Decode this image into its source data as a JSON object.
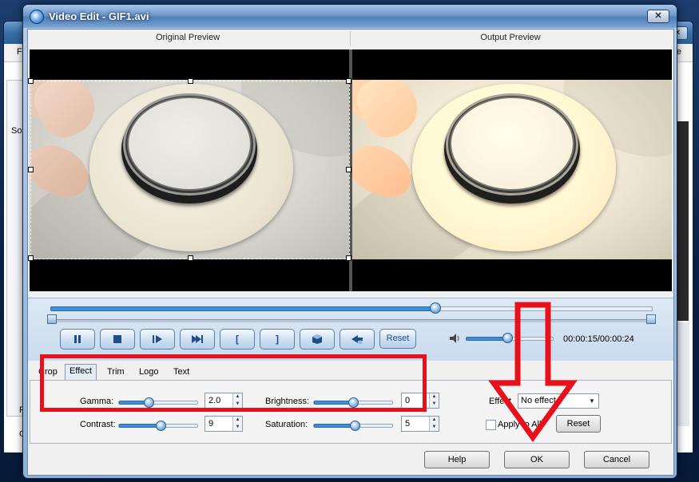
{
  "background_window": {
    "menu_left": "Fi",
    "menu_right": "e",
    "close_glyph": "✕",
    "label_so": "So",
    "label_f": "F",
    "label_c": "C"
  },
  "dialog": {
    "title": "Video Edit - GIF1.avi",
    "close_glyph": "✕"
  },
  "previews": {
    "original_label": "Original Preview",
    "output_label": "Output Preview"
  },
  "playback": {
    "position_fraction": 0.64,
    "volume_fraction": 0.48,
    "time": "00:00:15/00:00:24",
    "reset_label": "Reset",
    "bracket_open": "[",
    "bracket_close": "]"
  },
  "tabs": [
    {
      "label": "Crop",
      "active": false
    },
    {
      "label": "Effect",
      "active": true
    },
    {
      "label": "Trim",
      "active": false
    },
    {
      "label": "Logo",
      "active": false
    },
    {
      "label": "Text",
      "active": false
    }
  ],
  "effect_panel": {
    "gamma": {
      "label": "Gamma:",
      "value": "2.0",
      "fraction": 0.38
    },
    "contrast": {
      "label": "Contrast:",
      "value": "9",
      "fraction": 0.53
    },
    "brightness": {
      "label": "Brightness:",
      "value": "0",
      "fraction": 0.5
    },
    "saturation": {
      "label": "Saturation:",
      "value": "5",
      "fraction": 0.52
    },
    "effect_label": "Effect",
    "effect_value": "No effect",
    "apply_to_all": "Apply to All",
    "reset_label": "Reset"
  },
  "buttons": {
    "help": "Help",
    "ok": "OK",
    "cancel": "Cancel"
  },
  "colors": {
    "annotation_red": "#e8101a",
    "accent_blue": "#3e8fd9"
  }
}
